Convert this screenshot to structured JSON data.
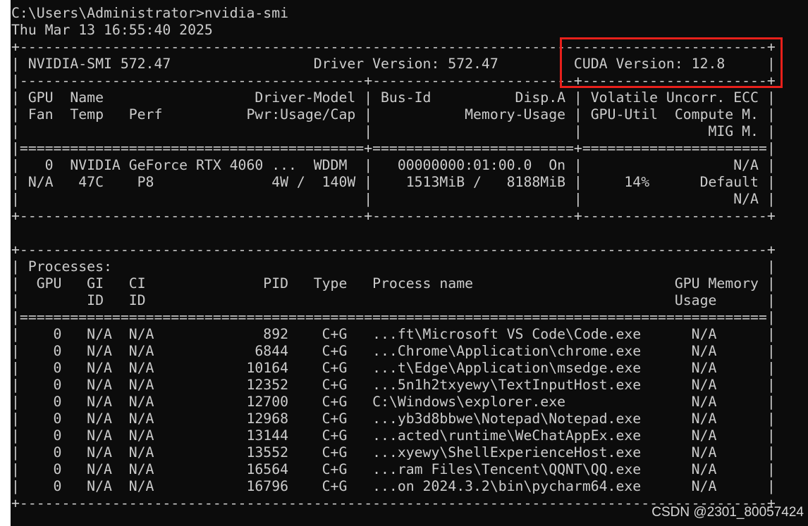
{
  "console": {
    "lines": [
      "C:\\Users\\Administrator>nvidia-smi",
      "Thu Mar 13 16:55:40 2025",
      "+-----------------------------------------------------------------------------------------+",
      "| NVIDIA-SMI 572.47                 Driver Version: 572.47         CUDA Version: 12.8     |",
      "|-----------------------------------------+------------------------+----------------------+",
      "| GPU  Name                  Driver-Model | Bus-Id          Disp.A | Volatile Uncorr. ECC |",
      "| Fan  Temp   Perf          Pwr:Usage/Cap |           Memory-Usage | GPU-Util  Compute M. |",
      "|                                         |                        |               MIG M. |",
      "|=========================================+========================+======================|",
      "|   0  NVIDIA GeForce RTX 4060 ...  WDDM  |   00000000:01:00.0  On |                  N/A |",
      "| N/A   47C    P8              4W /  140W |    1513MiB /   8188MiB |     14%      Default |",
      "|                                         |                        |                  N/A |",
      "+-----------------------------------------+------------------------+----------------------+",
      "",
      "+-----------------------------------------------------------------------------------------+",
      "| Processes:                                                                              |",
      "|  GPU   GI   CI              PID   Type   Process name                        GPU Memory |",
      "|        ID   ID                                                               Usage      |",
      "|=========================================================================================|",
      "|    0   N/A  N/A             892    C+G   ...ft\\Microsoft VS Code\\Code.exe      N/A      |",
      "|    0   N/A  N/A            6844    C+G   ...Chrome\\Application\\chrome.exe      N/A      |",
      "|    0   N/A  N/A           10164    C+G   ...t\\Edge\\Application\\msedge.exe      N/A      |",
      "|    0   N/A  N/A           12352    C+G   ...5n1h2txyewy\\TextInputHost.exe      N/A      |",
      "|    0   N/A  N/A           12700    C+G   C:\\Windows\\explorer.exe               N/A      |",
      "|    0   N/A  N/A           12968    C+G   ...yb3d8bbwe\\Notepad\\Notepad.exe      N/A      |",
      "|    0   N/A  N/A           13144    C+G   ...acted\\runtime\\WeChatAppEx.exe      N/A      |",
      "|    0   N/A  N/A           13552    C+G   ...xyewy\\ShellExperienceHost.exe      N/A      |",
      "|    0   N/A  N/A           16564    C+G   ...ram Files\\Tencent\\QQNT\\QQ.exe      N/A      |",
      "|    0   N/A  N/A           16796    C+G   ...on 2024.3.2\\bin\\pycharm64.exe      N/A      |",
      "+-----------------------------------------------------------------------------------------+"
    ]
  },
  "highlight": {
    "color": "#e8201b",
    "label": "CUDA Version: 12.8"
  },
  "watermark": "CSDN @2301_80057424"
}
